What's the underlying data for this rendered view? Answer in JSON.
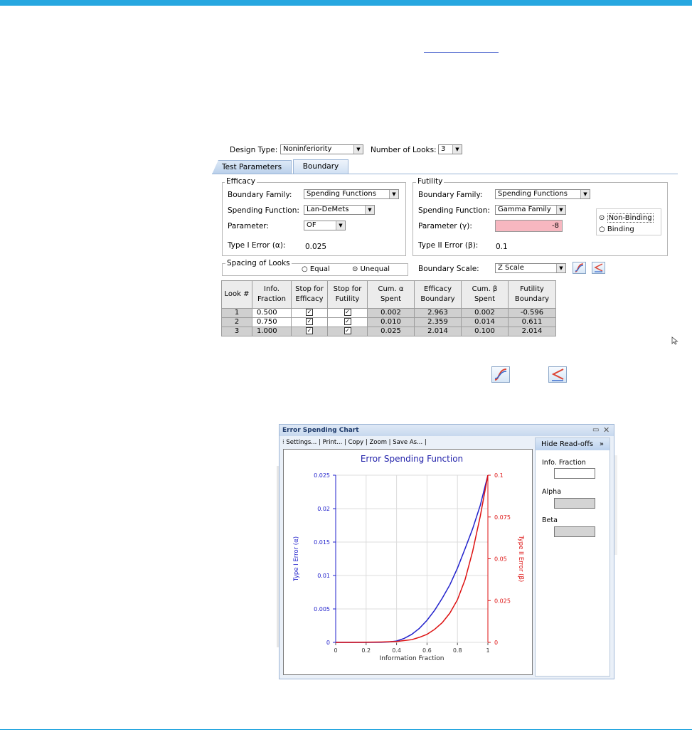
{
  "design": {
    "design_type_label": "Design Type:",
    "design_type_value": "Noninferiority",
    "looks_label": "Number of Looks:",
    "looks_value": "3"
  },
  "tabs": [
    {
      "label": "Test Parameters"
    },
    {
      "label": "Boundary"
    }
  ],
  "efficacy": {
    "title": "Efficacy",
    "boundary_family_label": "Boundary Family:",
    "boundary_family_value": "Spending Functions",
    "spending_function_label": "Spending Function:",
    "spending_function_value": "Lan-DeMets",
    "parameter_label": "Parameter:",
    "parameter_value": "OF",
    "type1_label": "Type I Error (α):",
    "type1_value": "0.025"
  },
  "futility": {
    "title": "Futility",
    "boundary_family_label": "Boundary Family:",
    "boundary_family_value": "Spending Functions",
    "spending_function_label": "Spending Function:",
    "spending_function_value": "Gamma Family",
    "parameter_label": "Parameter (γ):",
    "parameter_value": "-8",
    "type2_label": "Type II Error (β):",
    "type2_value": "0.1",
    "non_binding_label": "Non-Binding",
    "binding_label": "Binding"
  },
  "spacing": {
    "title": "Spacing of Looks",
    "equal_label": "Equal",
    "unequal_label": "Unequal"
  },
  "boundary_scale": {
    "label": "Boundary Scale:",
    "value": "Z Scale"
  },
  "table": {
    "headers": [
      {
        "l1": "Look #",
        "l2": ""
      },
      {
        "l1": "Info.",
        "l2": "Fraction"
      },
      {
        "l1": "Stop for",
        "l2": "Efficacy"
      },
      {
        "l1": "Stop for",
        "l2": "Futility"
      },
      {
        "l1": "Cum. α",
        "l2": "Spent"
      },
      {
        "l1": "Efficacy",
        "l2": "Boundary"
      },
      {
        "l1": "Cum. β",
        "l2": "Spent"
      },
      {
        "l1": "Futility",
        "l2": "Boundary"
      }
    ],
    "rows": [
      {
        "look": "1",
        "frac": "0.500",
        "cum_a": "0.002",
        "eff": "2.963",
        "cum_b": "0.002",
        "fut": "-0.596"
      },
      {
        "look": "2",
        "frac": "0.750",
        "cum_a": "0.010",
        "eff": "2.359",
        "cum_b": "0.014",
        "fut": "0.611"
      },
      {
        "look": "3",
        "frac": "1.000",
        "cum_a": "0.025",
        "eff": "2.014",
        "cum_b": "0.100",
        "fut": "2.014"
      }
    ]
  },
  "chart_window": {
    "title": "Error Spending Chart",
    "toolbar": [
      "Settings...",
      "Print...",
      "Copy",
      "Zoom",
      "Save As..."
    ],
    "hide_readoffs": "Hide Read-offs",
    "readoff_info": "Info. Fraction",
    "readoff_alpha": "Alpha",
    "readoff_beta": "Beta"
  },
  "chart_data": {
    "type": "line",
    "title": "Error Spending Function",
    "xlabel": "Information Fraction",
    "ylabel_left": "Type I Error (α)",
    "ylabel_right": "Type II Error (β)",
    "xlim": [
      0,
      1
    ],
    "ylim_left": [
      0,
      0.025
    ],
    "ylim_right": [
      0,
      0.1
    ],
    "x_ticks": [
      "0",
      "0.2",
      "0.4",
      "0.6",
      "0.8",
      "1"
    ],
    "y_left_ticks": [
      "0",
      "0.005",
      "0.01",
      "0.015",
      "0.02",
      "0.025"
    ],
    "y_right_ticks": [
      "0",
      "0.025",
      "0.05",
      "0.075",
      "0.1"
    ],
    "grid": true,
    "series": [
      {
        "axis": "left",
        "color": "#2222cc",
        "x": [
          0,
          0.1,
          0.2,
          0.3,
          0.35,
          0.4,
          0.45,
          0.5,
          0.55,
          0.6,
          0.65,
          0.7,
          0.75,
          0.8,
          0.85,
          0.9,
          0.95,
          1.0
        ],
        "y": [
          0,
          0,
          0,
          1e-05,
          6e-05,
          0.0002,
          0.0006,
          0.0012,
          0.0021,
          0.0033,
          0.0048,
          0.0066,
          0.0086,
          0.0111,
          0.014,
          0.017,
          0.0205,
          0.025
        ]
      },
      {
        "axis": "right",
        "color": "#dd1111",
        "x": [
          0,
          0.1,
          0.2,
          0.3,
          0.4,
          0.5,
          0.55,
          0.6,
          0.65,
          0.7,
          0.75,
          0.8,
          0.85,
          0.9,
          0.95,
          1.0
        ],
        "y": [
          0,
          0,
          0.0001,
          0.0002,
          0.0005,
          0.0016,
          0.003,
          0.0048,
          0.0078,
          0.0118,
          0.0175,
          0.0255,
          0.0375,
          0.0545,
          0.0755,
          0.1
        ]
      }
    ]
  },
  "colors": {
    "accent": "#27a7e0",
    "alpha_line": "#2222cc",
    "beta_line": "#dd1111",
    "param_bg": "#f7b7c0"
  }
}
